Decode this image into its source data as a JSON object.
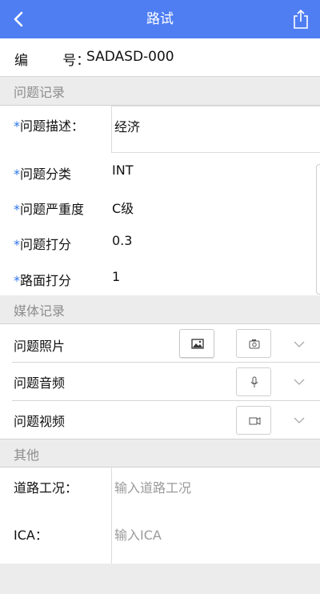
{
  "colors": {
    "nav": "#4f7ef3",
    "required": "#2e73e6",
    "background": "#ececec"
  },
  "header": {
    "title": "路试",
    "back_icon": "chevron-left-icon",
    "share_icon": "share-icon"
  },
  "id_row": {
    "label": "编        号：",
    "value": "SADASD-000"
  },
  "sections": {
    "problem_record": "问题记录",
    "media_record": "媒体记录",
    "other": "其他"
  },
  "problem": {
    "required_mark": "*",
    "description": {
      "label": "问题描述：",
      "value": "经济"
    },
    "category": {
      "label": "问题分类",
      "value": "INT"
    },
    "severity": {
      "label": "问题严重度",
      "value": "C级"
    },
    "score": {
      "label": "问题打分",
      "value": "0.3"
    },
    "road_score": {
      "label": "路面打分",
      "value": "1"
    }
  },
  "media": {
    "photo": {
      "label": "问题照片",
      "icons": [
        "image-icon",
        "camera-icon"
      ]
    },
    "audio": {
      "label": "问题音频",
      "icons": [
        "microphone-icon"
      ]
    },
    "video": {
      "label": "问题视频",
      "icons": [
        "video-camera-icon"
      ]
    }
  },
  "other": {
    "road_condition": {
      "label": "道路工况：",
      "placeholder": "输入道路工况"
    },
    "ica": {
      "label": "ICA：",
      "placeholder": "输入ICA"
    }
  }
}
